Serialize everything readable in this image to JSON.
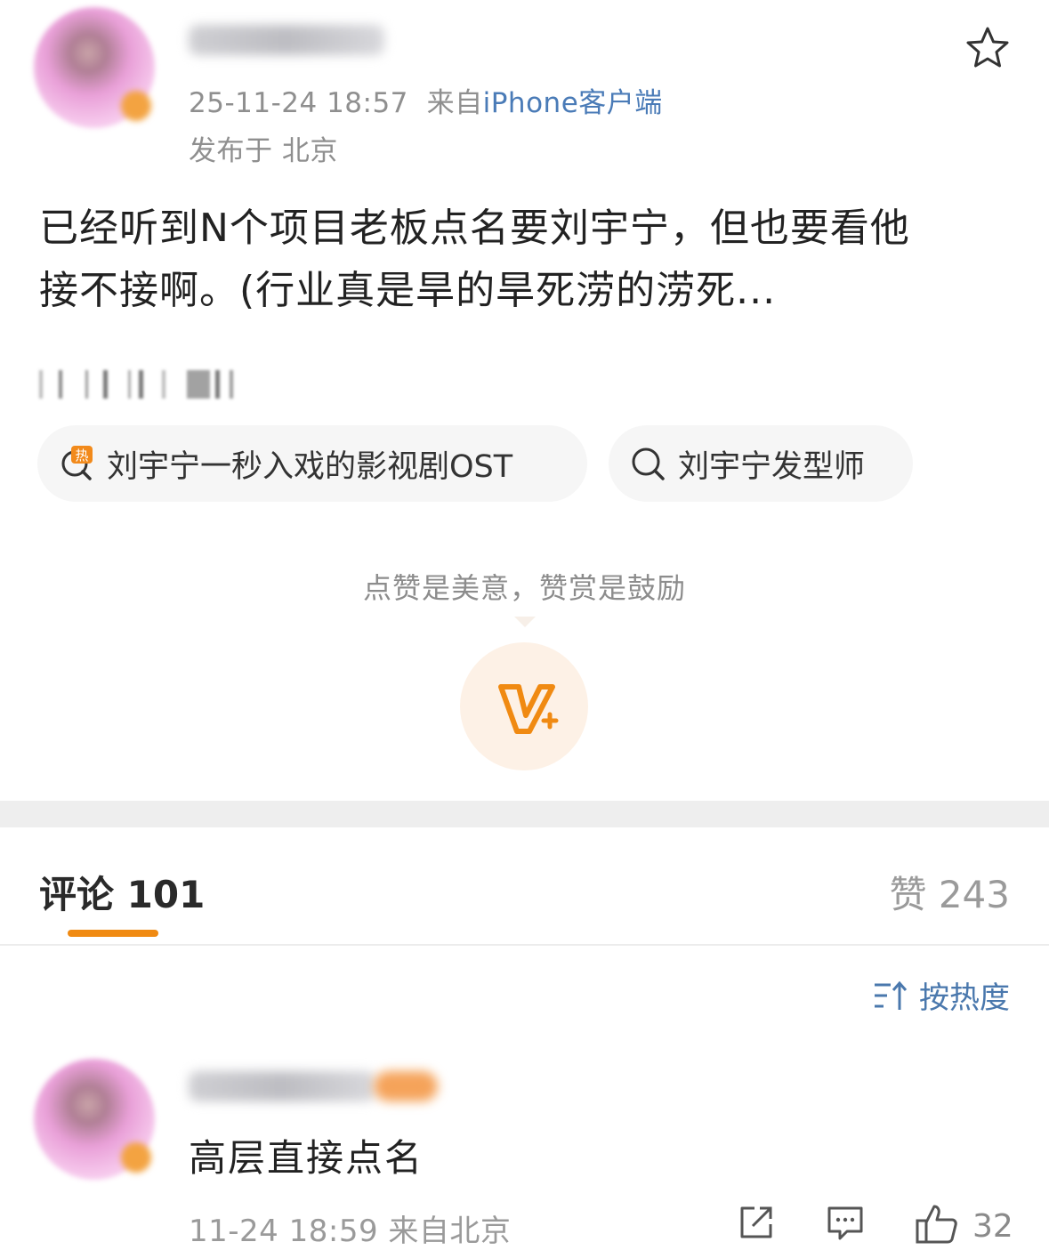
{
  "post": {
    "timestamp": "25-11-24 18:57",
    "source_prefix": "来自",
    "source_app": "iPhone客户端",
    "location": "发布于 北京",
    "text_line1": "已经听到N个项目老板点名要刘宇宁，但也要看他",
    "text_line2": "接不接啊。(行业真是旱的旱死涝的涝死..."
  },
  "topics": [
    {
      "label": "刘宇宁一秒入戏的影视剧OST",
      "icon": "hot-search-icon"
    },
    {
      "label": "刘宇宁发型师",
      "icon": "search-icon"
    }
  ],
  "reward": {
    "tip": "点赞是美意，赞赏是鼓励",
    "icon": "v-plus-reward-icon"
  },
  "comments_header": {
    "tab_label": "评论 101",
    "likes_label": "赞 243",
    "sort_label": "按热度"
  },
  "comment": {
    "text": "高层直接点名",
    "meta": "11-24 18:59 来自北京",
    "like_count": "32"
  },
  "colors": {
    "accent_orange": "#f08a12",
    "link_blue": "#4a7bb7",
    "meta_gray": "#8f8f8f"
  }
}
